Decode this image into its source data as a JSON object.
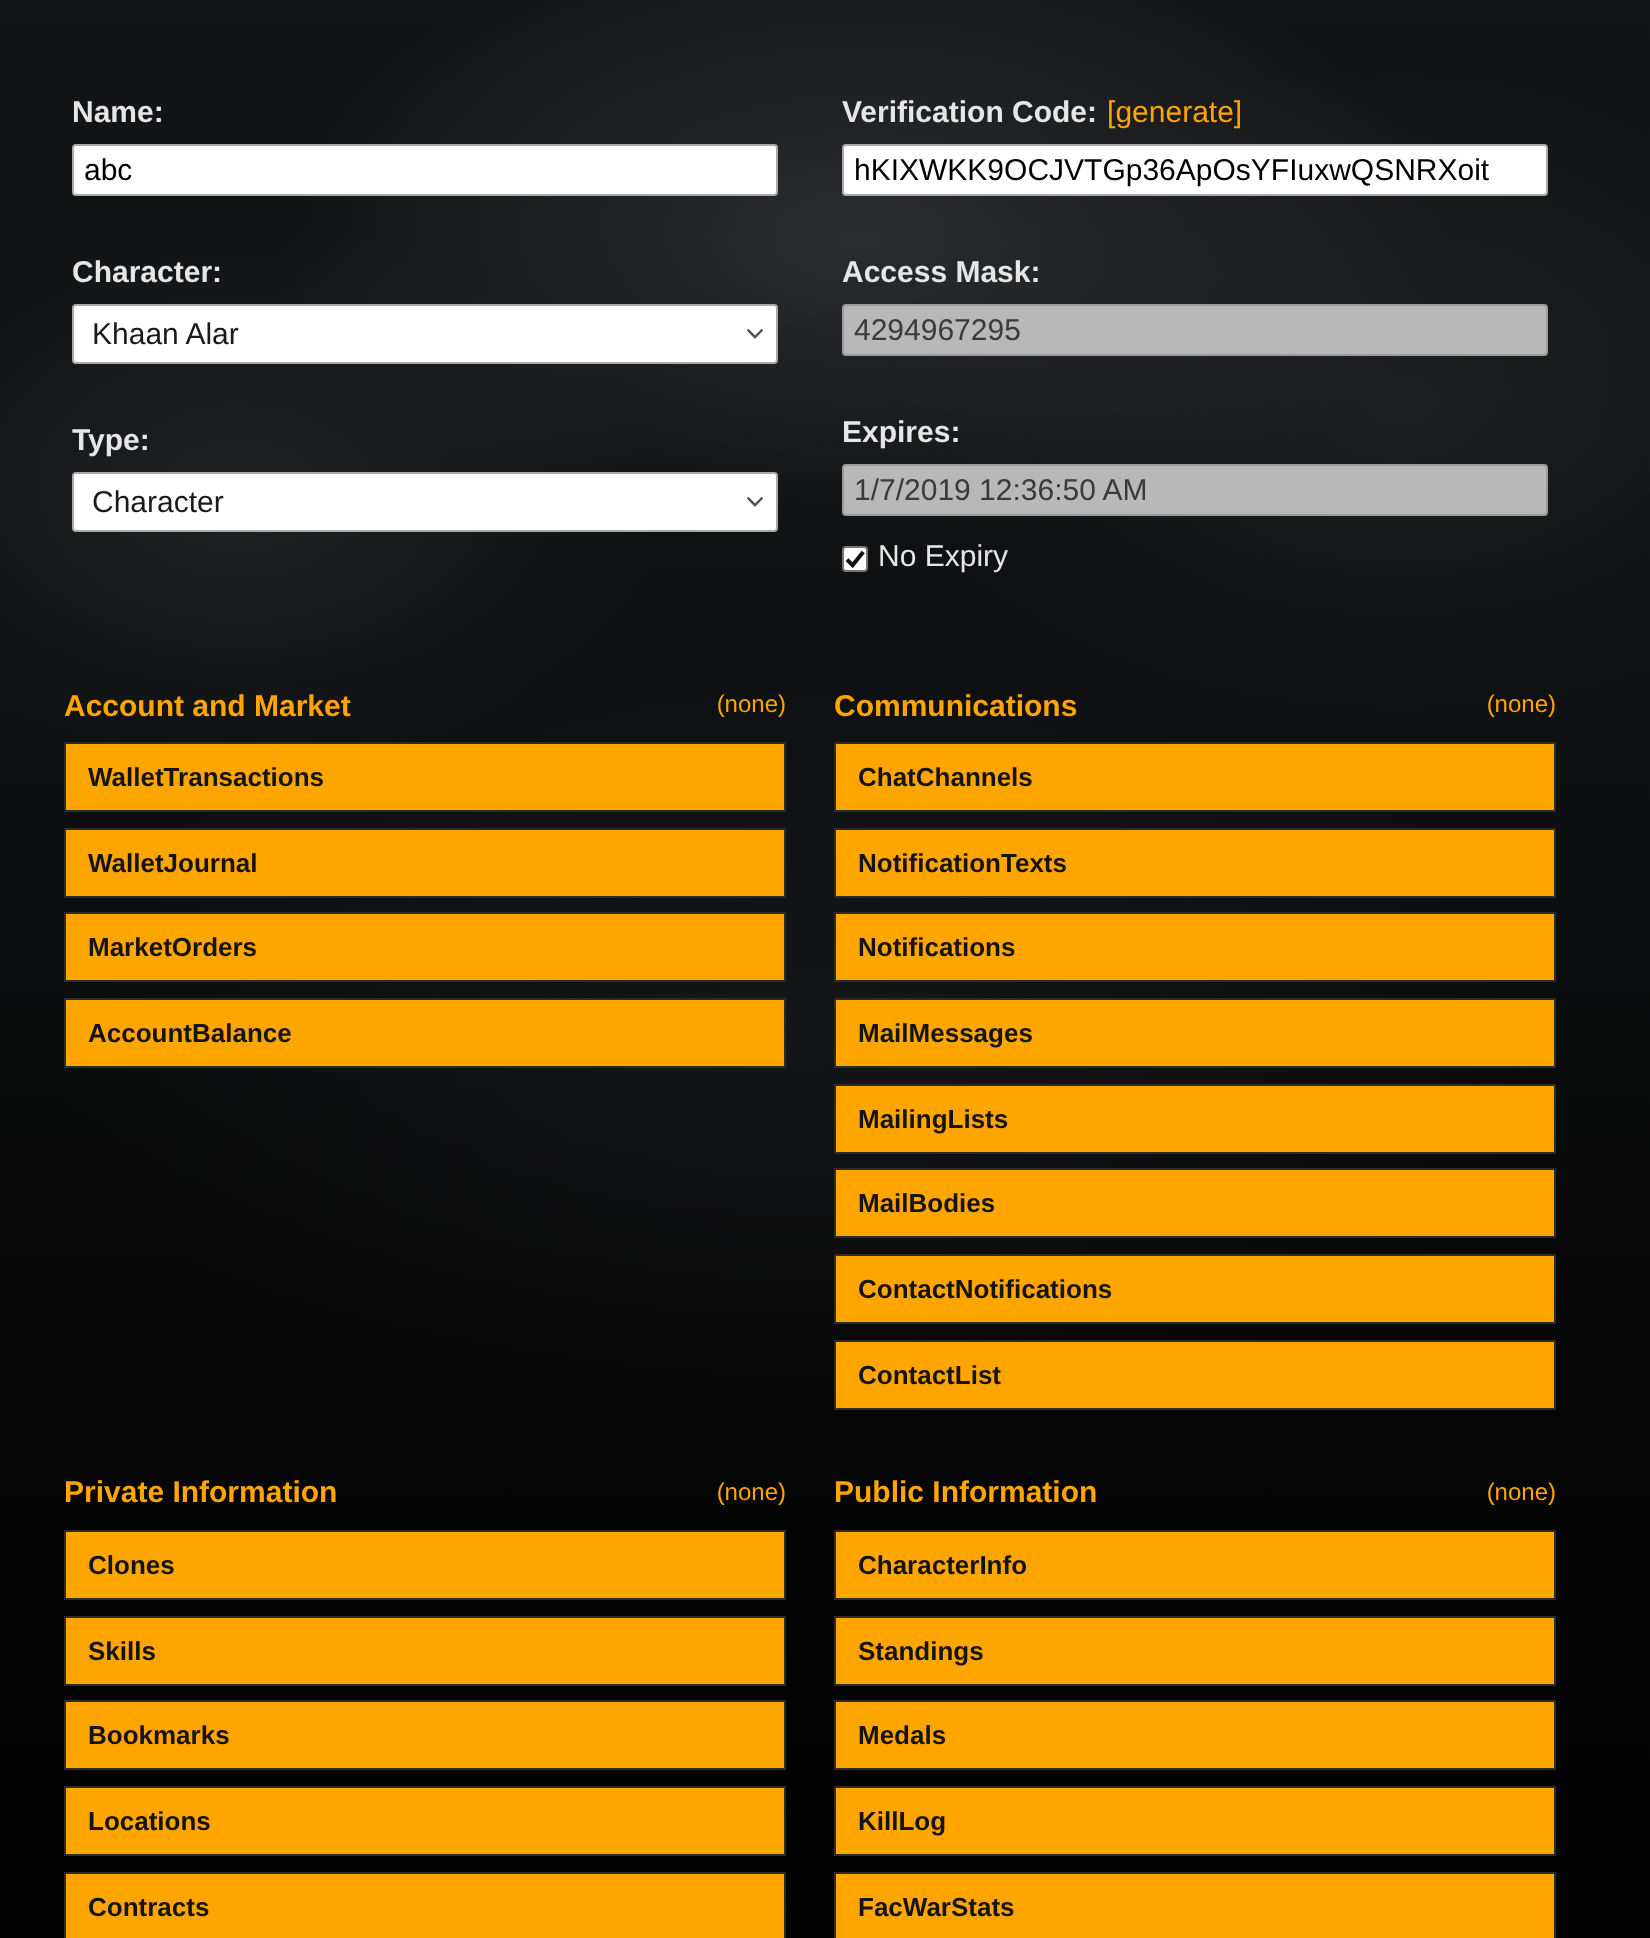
{
  "left_fields": [
    {
      "kind": "text",
      "label": "Name:",
      "value": "abc",
      "disabled": false
    },
    {
      "kind": "select",
      "label": "Character:",
      "value": "Khaan Alar"
    },
    {
      "kind": "select",
      "label": "Type:",
      "value": "Character"
    }
  ],
  "right_fields": [
    {
      "kind": "text",
      "label": "Verification Code:",
      "link": "[generate]",
      "value": "hKIXWKK9OCJVTGp36ApOsYFIuxwQSNRXoit",
      "disabled": false
    },
    {
      "kind": "text",
      "label": "Access Mask:",
      "value": "4294967295",
      "disabled": true
    },
    {
      "kind": "text",
      "label": "Expires:",
      "value": "1/7/2019 12:36:50 AM",
      "disabled": true,
      "option": {
        "label": "No Expiry",
        "checked": true
      }
    }
  ],
  "sections": [
    {
      "title": "Account and Market",
      "summary": "(none)",
      "items": [
        "WalletTransactions",
        "WalletJournal",
        "MarketOrders",
        "AccountBalance"
      ]
    },
    {
      "title": "Communications",
      "summary": "(none)",
      "items": [
        "ChatChannels",
        "NotificationTexts",
        "Notifications",
        "MailMessages",
        "MailingLists",
        "MailBodies",
        "ContactNotifications",
        "ContactList"
      ]
    },
    {
      "title": "Private Information",
      "summary": "(none)",
      "items": [
        "Clones",
        "Skills",
        "Bookmarks",
        "Locations",
        "Contracts"
      ]
    },
    {
      "title": "Public Information",
      "summary": "(none)",
      "items": [
        "CharacterInfo",
        "Standings",
        "Medals",
        "KillLog",
        "FacWarStats"
      ]
    }
  ]
}
